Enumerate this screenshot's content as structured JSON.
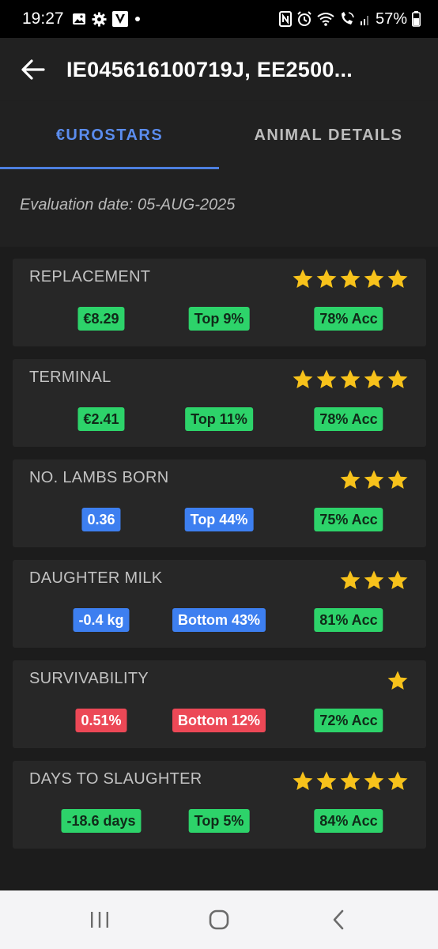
{
  "status_bar": {
    "time": "19:27",
    "battery": "57%",
    "icons": [
      "gallery-icon",
      "settings-icon",
      "v-app-icon",
      "dot-icon",
      "nfc-icon",
      "alarm-icon",
      "wifi-icon",
      "wifi-call-icon",
      "signal-icon",
      "battery-icon"
    ]
  },
  "app_bar": {
    "title": "IE045616100719J, EE2500..."
  },
  "tabs": [
    {
      "label": "€UROSTARS",
      "active": true
    },
    {
      "label": "ANIMAL DETAILS",
      "active": false
    }
  ],
  "evaluation_date": "Evaluation date: 05-AUG-2025",
  "colors": {
    "green": "#2dd36a",
    "blue": "#3d7ff0",
    "red": "#ec4856",
    "star": "#f7c21b",
    "accent": "#5b8def"
  },
  "cards": [
    {
      "title": "REPLACEMENT",
      "stars": 5,
      "value": "€8.29",
      "rank": "Top 9%",
      "accuracy": "78% Acc",
      "color": "green"
    },
    {
      "title": "TERMINAL",
      "stars": 5,
      "value": "€2.41",
      "rank": "Top 11%",
      "accuracy": "78% Acc",
      "color": "green"
    },
    {
      "title": "NO. LAMBS BORN",
      "stars": 3,
      "value": "0.36",
      "rank": "Top 44%",
      "accuracy": "75% Acc",
      "color": "blue"
    },
    {
      "title": "DAUGHTER MILK",
      "stars": 3,
      "value": "-0.4 kg",
      "rank": "Bottom 43%",
      "accuracy": "81% Acc",
      "color": "blue"
    },
    {
      "title": "SURVIVABILITY",
      "stars": 1,
      "value": "0.51%",
      "rank": "Bottom 12%",
      "accuracy": "72% Acc",
      "color": "red"
    },
    {
      "title": "DAYS TO SLAUGHTER",
      "stars": 5,
      "value": "-18.6 days",
      "rank": "Top 5%",
      "accuracy": "84% Acc",
      "color": "green"
    }
  ],
  "nav_bar": {
    "buttons": [
      "recents-icon",
      "home-icon",
      "back-nav-icon"
    ]
  }
}
